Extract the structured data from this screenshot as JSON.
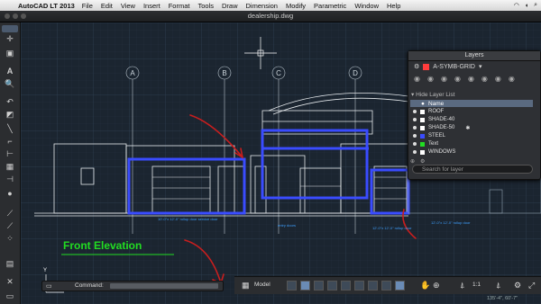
{
  "menubar": {
    "apple": "",
    "app": "AutoCAD LT 2013",
    "items": [
      "File",
      "Edit",
      "View",
      "Insert",
      "Format",
      "Tools",
      "Draw",
      "Dimension",
      "Modify",
      "Parametric",
      "Window",
      "Help"
    ]
  },
  "window": {
    "title": "dealership.dwg"
  },
  "drawing": {
    "grid_bubbles": [
      "A",
      "B",
      "C",
      "D"
    ],
    "title": "Front Elevation",
    "notes": [
      "10'-0\"x 12'-0\" rollup door service door",
      "entry doors",
      "12'-0\"x 12'-0\" rollup door",
      "12'-0\"x 12'-0\" rollup door"
    ],
    "ucs_y": "Y"
  },
  "layers_palette": {
    "title": "Layers",
    "current_layer": "A-SYMB-GRID",
    "hide_list_label": "Hide Layer List",
    "column_header": "Name",
    "rows": [
      {
        "name": "ROOF",
        "color": "#ffffff"
      },
      {
        "name": "SHADE-40",
        "color": "#ffffff"
      },
      {
        "name": "SHADE-50",
        "color": "#ffffff"
      },
      {
        "name": "STEEL",
        "color": "#3a4cff"
      },
      {
        "name": "Text",
        "color": "#22dd22"
      },
      {
        "name": "WINDOWS",
        "color": "#ffffff"
      }
    ],
    "search_placeholder": "Search for layer"
  },
  "command": {
    "label": "Command:"
  },
  "status": {
    "model_label": "Model",
    "scale": "1:1",
    "coords": "135'-4\", 60'-7\""
  }
}
